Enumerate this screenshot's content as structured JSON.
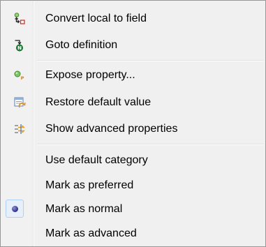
{
  "menu": {
    "items": [
      {
        "label": "Convert local to field",
        "icon": "convert-local-to-field-icon"
      },
      {
        "label": "Goto definition",
        "icon": "goto-definition-icon"
      },
      {
        "label": "Expose property...",
        "icon": "expose-property-icon"
      },
      {
        "label": "Restore default value",
        "icon": "restore-default-icon"
      },
      {
        "label": "Show advanced properties",
        "icon": "advanced-properties-icon"
      },
      {
        "label": "Use default category",
        "icon": ""
      },
      {
        "label": "Mark as preferred",
        "icon": ""
      },
      {
        "label": "Mark as normal",
        "icon": "radio-selected-icon",
        "checked": true
      },
      {
        "label": "Mark as advanced",
        "icon": ""
      }
    ]
  },
  "colors": {
    "menu_bg": "#f0f0f0",
    "border": "#979797",
    "checked_bg": "#e6effa",
    "checked_border": "#aecff7",
    "radio": "#2d2d8a"
  }
}
